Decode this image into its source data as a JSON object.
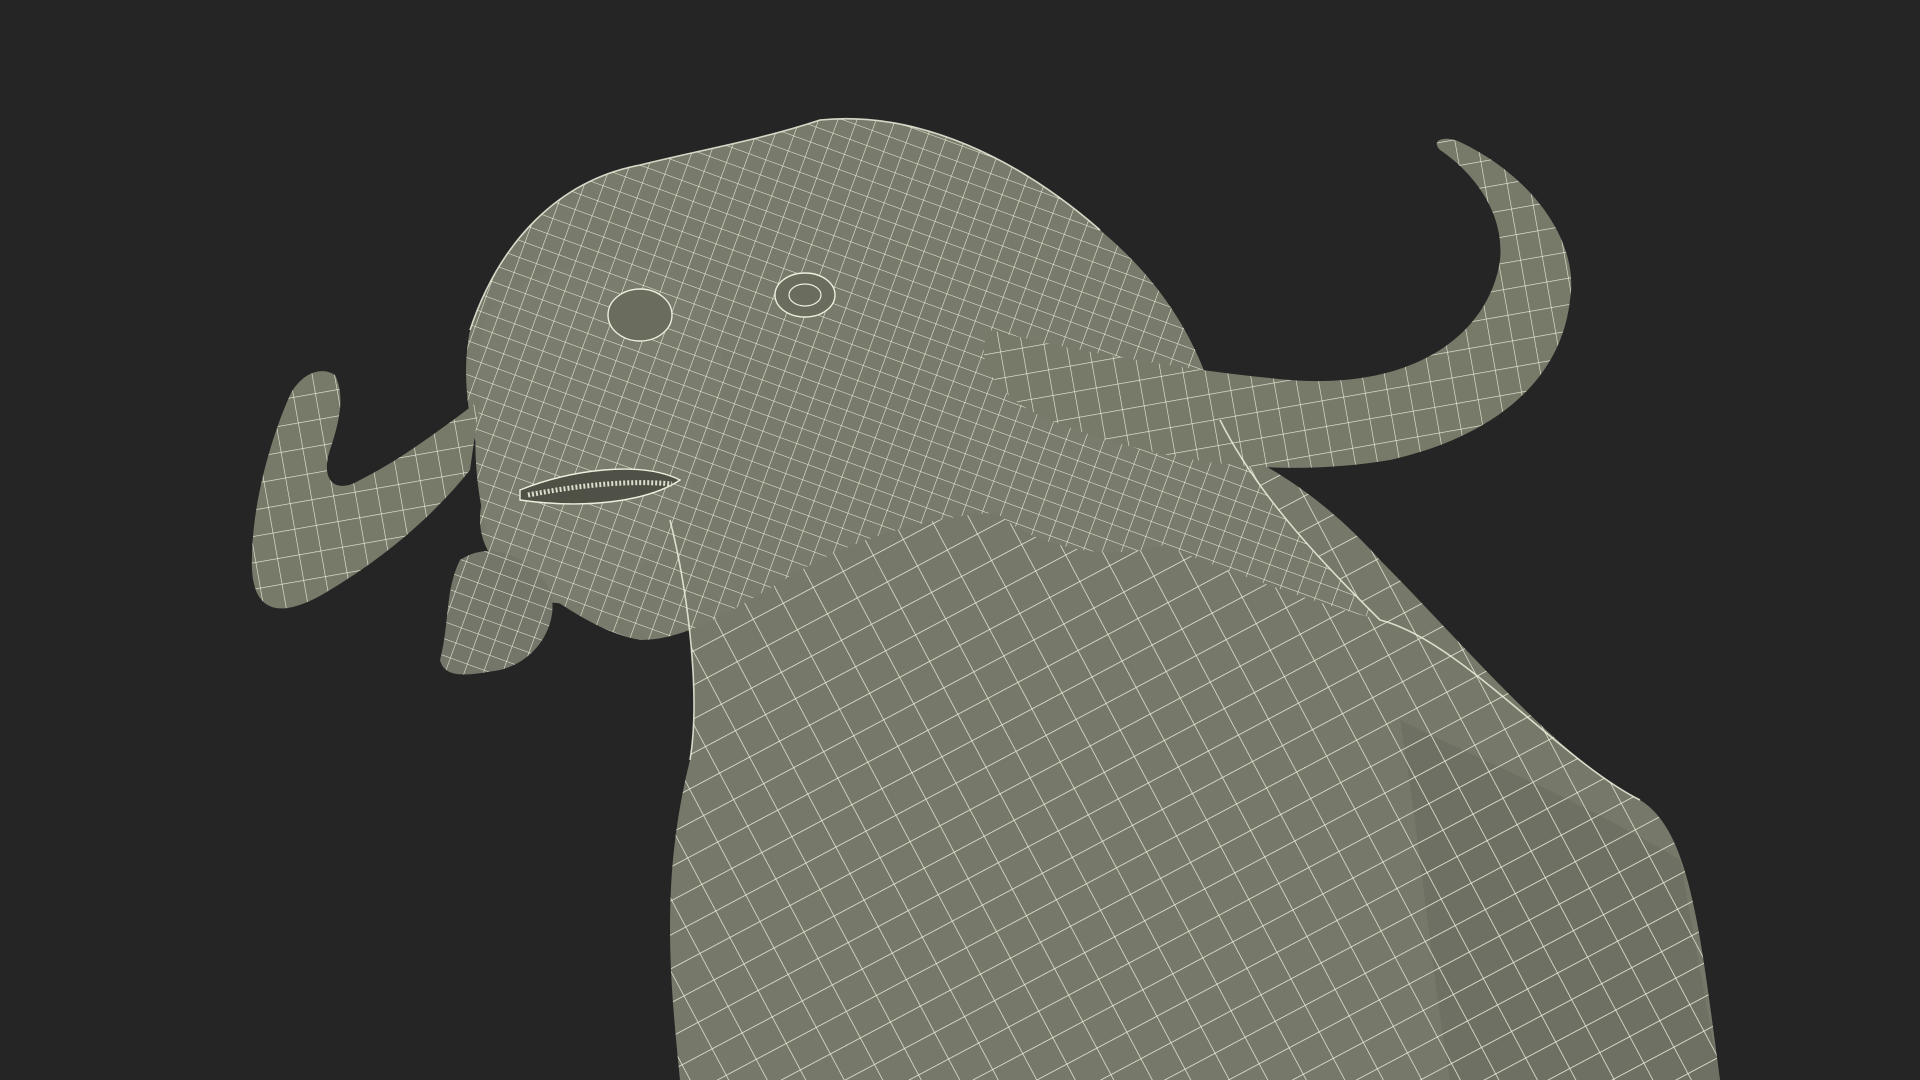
{
  "scene": {
    "background_color": "#252525",
    "mesh_fill_color": "#767869",
    "mesh_shadow_color": "#5f6155",
    "wireframe_color": "#eeeedd",
    "subject": "buffalo-head-wireframe"
  }
}
